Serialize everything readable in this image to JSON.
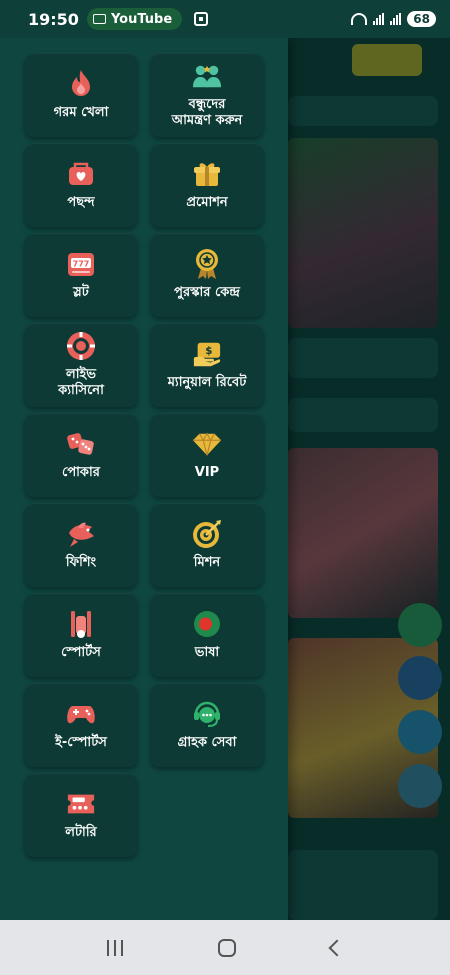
{
  "status_bar": {
    "time": "19:50",
    "app_pill": "YouTube",
    "battery": "68"
  },
  "colors": {
    "drawer_bg": "#0f4740",
    "tile_bg": "#0d3a35",
    "accent_red": "#e8605a",
    "accent_gold": "#e8b83a",
    "accent_green": "#2fb36b"
  },
  "menu": {
    "items": [
      {
        "label": "গরম খেলা",
        "icon": "fire-icon"
      },
      {
        "label": "বন্ধুদের\nআমন্ত্রণ করুন",
        "icon": "invite-friends-icon"
      },
      {
        "label": "পছন্দ",
        "icon": "favorite-icon"
      },
      {
        "label": "প্রমোশন",
        "icon": "gift-icon"
      },
      {
        "label": "স্লট",
        "icon": "slot-machine-icon"
      },
      {
        "label": "পুরস্কার কেন্দ্র",
        "icon": "reward-medal-icon"
      },
      {
        "label": "লাইভ\nক্যাসিনো",
        "icon": "casino-chip-icon"
      },
      {
        "label": "ম্যানুয়াল রিবেট",
        "icon": "rebate-icon"
      },
      {
        "label": "পোকার",
        "icon": "dice-icon"
      },
      {
        "label": "VIP",
        "icon": "vip-diamond-icon"
      },
      {
        "label": "ফিশিং",
        "icon": "fish-icon"
      },
      {
        "label": "মিশন",
        "icon": "target-icon"
      },
      {
        "label": "স্পোর্টস",
        "icon": "cricket-icon"
      },
      {
        "label": "ভাষা",
        "icon": "bangladesh-flag-icon"
      },
      {
        "label": "ই-স্পোর্টস",
        "icon": "gamepad-icon"
      },
      {
        "label": "গ্রাহক সেবা",
        "icon": "customer-service-icon"
      },
      {
        "label": "লটারি",
        "icon": "lottery-ticket-icon"
      }
    ]
  }
}
